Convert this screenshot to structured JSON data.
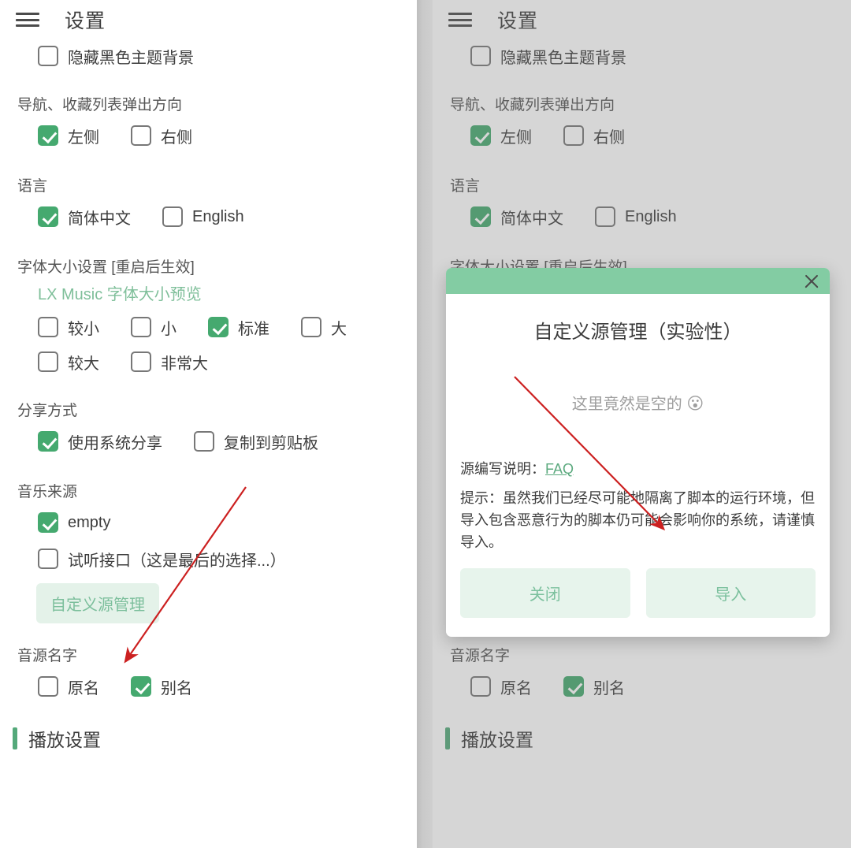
{
  "header": {
    "menu_icon": "hamburger-menu-icon",
    "title": "设置"
  },
  "settings": {
    "hide_dark_bg": {
      "label": "隐藏黑色主题背景",
      "checked": false
    },
    "popup_direction": {
      "group_label": "导航、收藏列表弹出方向",
      "options": [
        {
          "label": "左侧",
          "checked": true
        },
        {
          "label": "右侧",
          "checked": false
        }
      ]
    },
    "language": {
      "group_label": "语言",
      "options": [
        {
          "label": "简体中文",
          "checked": true
        },
        {
          "label": "English",
          "checked": false
        }
      ]
    },
    "font_size": {
      "group_label": "字体大小设置 [重启后生效]",
      "preview": "LX Music 字体大小预览",
      "options_row1": [
        {
          "label": "较小",
          "checked": false
        },
        {
          "label": "小",
          "checked": false
        },
        {
          "label": "标准",
          "checked": true
        },
        {
          "label": "大",
          "checked": false
        }
      ],
      "options_row2": [
        {
          "label": "较大",
          "checked": false
        },
        {
          "label": "非常大",
          "checked": false
        }
      ]
    },
    "share_mode": {
      "group_label": "分享方式",
      "options": [
        {
          "label": "使用系统分享",
          "checked": true
        },
        {
          "label": "复制到剪贴板",
          "checked": false
        }
      ]
    },
    "music_source": {
      "group_label": "音乐来源",
      "options": [
        {
          "label": "empty",
          "checked": true
        },
        {
          "label": "试听接口（这是最后的选择...）",
          "checked": false
        }
      ],
      "custom_source_button": "自定义源管理"
    },
    "source_name": {
      "group_label": "音源名字",
      "options": [
        {
          "label": "原名",
          "checked": false
        },
        {
          "label": "别名",
          "checked": true
        }
      ]
    },
    "playback_section": "播放设置"
  },
  "dialog": {
    "close_icon": "close-x-icon",
    "title": "自定义源管理（实验性）",
    "empty_text": "这里竟然是空的",
    "empty_emoji": "😮",
    "faq_label": "源编写说明：",
    "faq_link": "FAQ",
    "note": "提示：虽然我们已经尽可能地隔离了脚本的运行环境，但导入包含恶意行为的脚本仍可能会影响你的系统，请谨慎导入。",
    "close_button": "关闭",
    "import_button": "导入"
  },
  "colors": {
    "accent_green": "#45a96f",
    "header_green": "#83cca3",
    "pill_bg": "#e4f2e9",
    "annotation_red": "#cc2020",
    "scrim": "rgba(120,120,120,0.30)"
  }
}
